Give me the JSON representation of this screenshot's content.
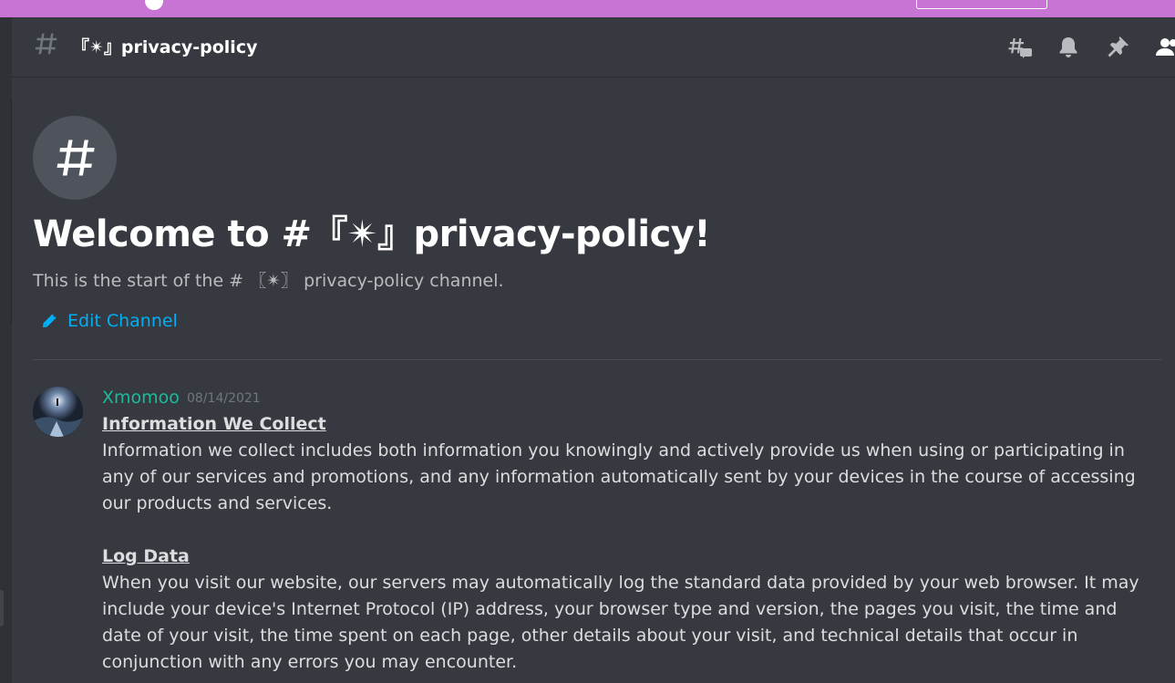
{
  "header": {
    "channel_name": "『✴』privacy-policy",
    "icons": [
      "threads-icon",
      "bell-icon",
      "pin-icon",
      "member-list-icon"
    ]
  },
  "intro": {
    "welcome": "Welcome to #『✴』privacy-policy!",
    "start_text": "This is the start of the # 〖✴〗 privacy-policy channel.",
    "edit_label": "Edit Channel"
  },
  "message": {
    "author": "Xmomoo",
    "timestamp": "08/14/2021",
    "sections": [
      {
        "heading": "Information We Collect",
        "text": "Information we collect includes both information you knowingly and actively provide us when using or participating in any of our services and promotions, and any information automatically sent by your devices in the course of accessing our products and services."
      },
      {
        "heading": "Log Data",
        "text": "When you visit our website, our servers may automatically log the standard data provided by your web browser. It may include your device's Internet Protocol (IP) address, your browser type and version, the pages you visit, the time and date of your visit, the time spent on each page, other details about your visit, and technical details that occur in conjunction with any errors you may encounter."
      }
    ]
  },
  "colors": {
    "background": "#36393f",
    "banner": "#c774d4",
    "link": "#00aff4",
    "username": "#1abc9c",
    "muted": "#b9bbbe"
  }
}
